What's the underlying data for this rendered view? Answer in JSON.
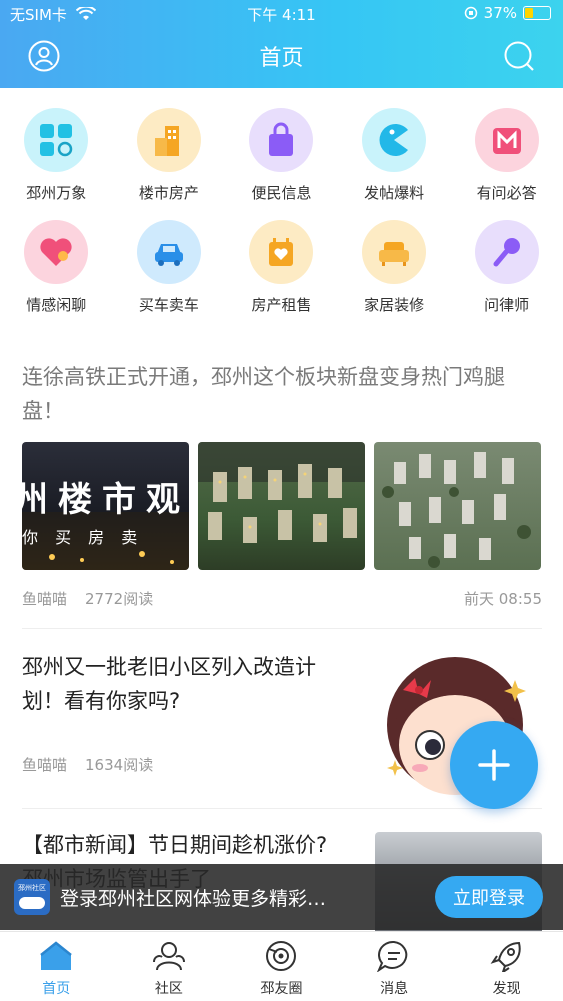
{
  "status": {
    "carrier": "无SIM卡",
    "time": "下午 4:11",
    "battery": "37%",
    "battery_level": 0.37
  },
  "nav": {
    "title": "首页",
    "left_icon": "user-icon",
    "right_icon": "search-icon"
  },
  "grid": [
    {
      "label": "邳州万象",
      "icon": "grid-apps-icon",
      "color": "#25c6e6"
    },
    {
      "label": "楼市房产",
      "icon": "buildings-icon",
      "color": "#f5a623"
    },
    {
      "label": "便民信息",
      "icon": "shopping-bag-icon",
      "color": "#8b5cf6"
    },
    {
      "label": "发帖爆料",
      "icon": "pacman-icon",
      "color": "#22b8e8"
    },
    {
      "label": "有问必答",
      "icon": "m-logo-icon",
      "color": "#f0507a"
    },
    {
      "label": "情感闲聊",
      "icon": "heart-icon",
      "color": "#f0507a"
    },
    {
      "label": "买车卖车",
      "icon": "car-icon",
      "color": "#2a8fe8"
    },
    {
      "label": "房产租售",
      "icon": "house-heart-icon",
      "color": "#f5a623"
    },
    {
      "label": "家居装修",
      "icon": "sofa-icon",
      "color": "#f5a623"
    },
    {
      "label": "问律师",
      "icon": "microphone-icon",
      "color": "#8b5cf6"
    }
  ],
  "article1": {
    "title": "连徐高铁正式开通，邳州这个板块新盘变身热门鸡腿盘！",
    "thumb_text_big": "州楼市观",
    "thumb_text_small": "你 买 房 卖",
    "author": "鱼喵喵",
    "reads": "2772阅读",
    "time": "前天 08:55"
  },
  "article2": {
    "title": "邳州又一批老旧小区列入改造计划！看有你家吗?",
    "author": "鱼喵喵",
    "reads": "1634阅读"
  },
  "article3": {
    "title": "【都市新闻】节日期间趁机涨价? 邳州市场监管出手了"
  },
  "login_bar": {
    "logo_text": "邳州社区",
    "text": "登录邳州社区网体验更多精彩…",
    "button": "立即登录"
  },
  "tabs": [
    {
      "label": "首页",
      "icon": "home-icon",
      "active": true
    },
    {
      "label": "社区",
      "icon": "community-icon",
      "active": false
    },
    {
      "label": "邳友圈",
      "icon": "moments-icon",
      "active": false
    },
    {
      "label": "消息",
      "icon": "message-icon",
      "active": false
    },
    {
      "label": "发现",
      "icon": "rocket-icon",
      "active": false
    }
  ],
  "colors": {
    "accent": "#35a9f2",
    "header_start": "#4aa8f2",
    "header_end": "#3cd3ee"
  }
}
